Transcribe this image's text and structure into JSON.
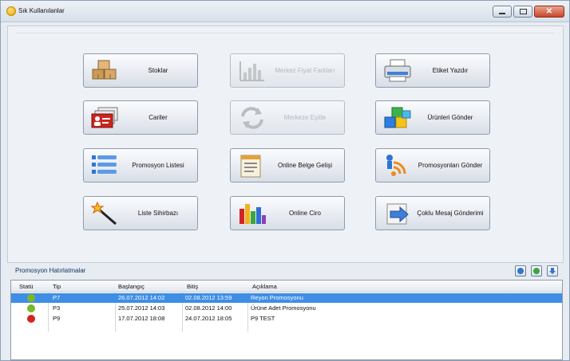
{
  "window": {
    "title": "Sık Kullanılanlar",
    "min_label": "",
    "max_label": "",
    "close_label": "✕"
  },
  "buttons": {
    "stoklar": "Stoklar",
    "cariler": "Cariler",
    "promosyon_listesi": "Promosyon Listesi",
    "liste_sihirbazi": "Liste Sihirbazı",
    "merkez_fiyat_farklari": "Merkez Fiyat Farkları",
    "merkeze_esitle": "Merkeze Eşitle",
    "online_belge_gelisi": "Online Belge Gelişi",
    "online_ciro": "Online Ciro",
    "etiket_yazdir": "Etiket Yazdır",
    "urunleri_gonder": "Ürünleri Gönder",
    "promosyonlari_gonder": "Promosyonları Gönder",
    "coklu_mesaj_gonderimi": "Çoklu Mesaj Gönderimi"
  },
  "promo_section": {
    "title": "Promosyon Hatırlatmalar"
  },
  "table": {
    "headers": [
      "Statü",
      "Tip",
      "Başlangıç",
      "Bitiş",
      "Açıklama"
    ],
    "rows": [
      {
        "status_color": "#7bb829",
        "tip": "P7",
        "baslangic": "26.07.2012 14:02",
        "bitis": "02.08.2012 13:59",
        "aciklama": "Reyon Promosyonu"
      },
      {
        "status_color": "#7bb829",
        "tip": "P3",
        "baslangic": "25.07.2012 14:03",
        "bitis": "02.08.2012 14:00",
        "aciklama": "Ürüne Adet Promosyonu"
      },
      {
        "status_color": "#d42323",
        "tip": "P9",
        "baslangic": "17.07.2012 18:08",
        "bitis": "24.07.2012 18:05",
        "aciklama": "P9 TEST"
      }
    ]
  },
  "colors": {
    "accent": "#3f8ee6",
    "active_status": "#7bb829",
    "expired_status": "#d42323"
  },
  "icons": [
    "app-icon",
    "boxes-icon",
    "person-card-icon",
    "list-icon",
    "magic-wand-icon",
    "bar-chart-gray-icon",
    "sync-arrows-icon",
    "document-icon",
    "colored-bars-icon",
    "printer-icon",
    "cubes-icon",
    "rss-person-icon",
    "send-arrow-icon",
    "info-icon",
    "refresh-icon",
    "down-arrow-icon"
  ]
}
